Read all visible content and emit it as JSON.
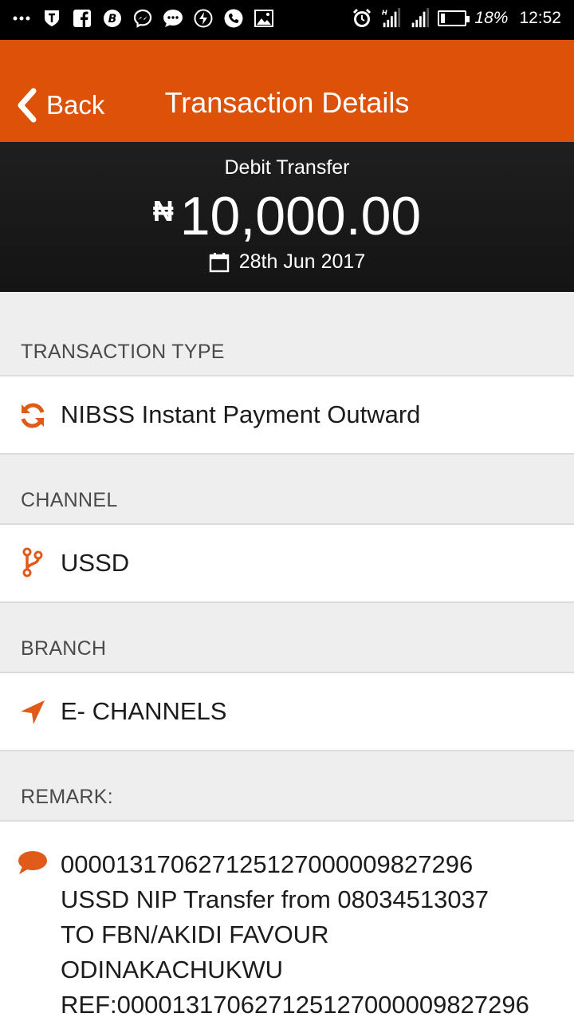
{
  "status_bar": {
    "left_icons": [
      "more-dots-icon",
      "shield-icon",
      "facebook-icon",
      "b-app-icon",
      "messenger-icon",
      "chat-bubble-icon",
      "lightning-icon",
      "phone-icon",
      "image-icon"
    ],
    "right_icons": [
      "alarm-icon",
      "signal-h-icon",
      "signal-icon",
      "battery-icon"
    ],
    "battery_percent": "18%",
    "battery_level": 0.18,
    "time": "12:52"
  },
  "app_bar": {
    "back_label": "Back",
    "title": "Transaction Details",
    "color": "#dd5109"
  },
  "summary": {
    "type": "Debit Transfer",
    "currency_symbol": "₦",
    "amount": "10,000.00",
    "date": "28th Jun 2017"
  },
  "details": {
    "transaction_type": {
      "label": "TRANSACTION TYPE",
      "value": "NIBSS Instant Payment Outward",
      "icon": "refresh-icon"
    },
    "channel": {
      "label": "CHANNEL",
      "value": "USSD",
      "icon": "code-branch-icon"
    },
    "branch": {
      "label": "BRANCH",
      "value": "E- CHANNELS",
      "icon": "location-arrow-icon"
    },
    "remark": {
      "label": "REMARK:",
      "icon": "comment-icon",
      "lines": [
        "000013170627125127000009827296",
        "USSD NIP Transfer from 08034513037",
        "TO FBN/AKIDI FAVOUR",
        "ODINAKACHUKWU",
        "REF:000013170627125127000009827296"
      ]
    }
  },
  "accent_color": "#e05a1a"
}
